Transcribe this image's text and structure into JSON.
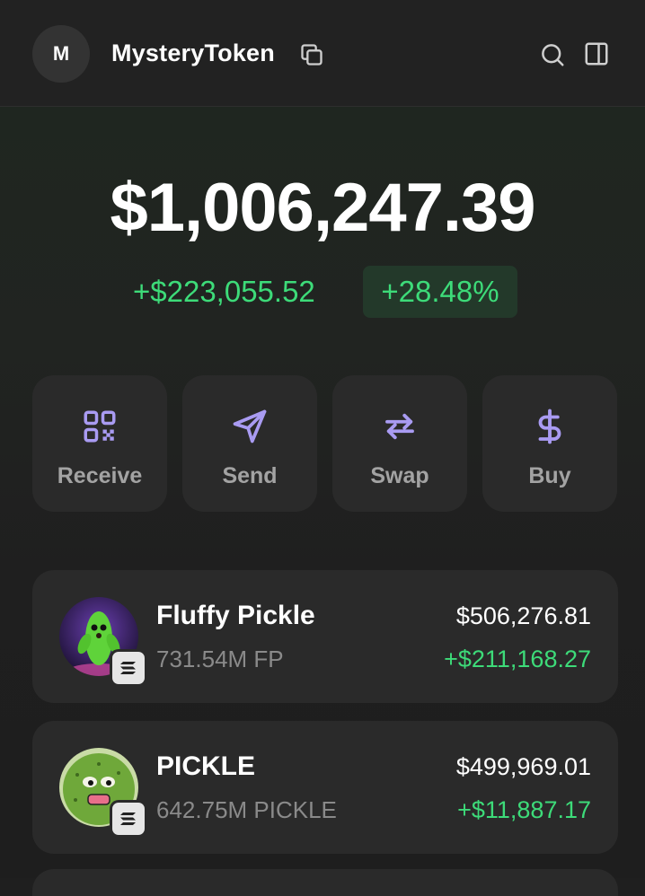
{
  "header": {
    "avatar_initial": "M",
    "account_name": "MysteryToken"
  },
  "portfolio": {
    "balance": "$1,006,247.39",
    "change_value": "+$223,055.52",
    "change_percent": "+28.48%"
  },
  "actions": [
    {
      "label": "Receive",
      "icon": "qr-code-icon"
    },
    {
      "label": "Send",
      "icon": "send-icon"
    },
    {
      "label": "Swap",
      "icon": "swap-icon"
    },
    {
      "label": "Buy",
      "icon": "dollar-icon"
    }
  ],
  "tokens": [
    {
      "name": "Fluffy Pickle",
      "amount": "731.54M FP",
      "value": "$506,276.81",
      "pnl": "+$211,168.27",
      "chain_icon": "solana-icon"
    },
    {
      "name": "PICKLE",
      "amount": "642.75M PICKLE",
      "value": "$499,969.01",
      "pnl": "+$11,887.17",
      "chain_icon": "solana-icon"
    }
  ],
  "colors": {
    "background": "#1f1f1f",
    "card": "#2a2a2a",
    "accent": "#a99bf2",
    "positive": "#3ddb79",
    "muted_text": "#a3a3a3"
  }
}
